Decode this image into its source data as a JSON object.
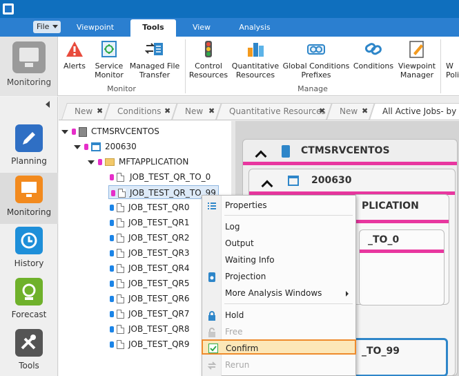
{
  "ribbon_tabs": [
    {
      "label": "Viewpoint"
    },
    {
      "label": "Tools",
      "active": true
    },
    {
      "label": "View"
    },
    {
      "label": "Analysis"
    }
  ],
  "file_button": {
    "label": "File"
  },
  "monitoring_panel": {
    "label": "Monitoring"
  },
  "ribbon": {
    "monitor_group": {
      "label": "Monitor",
      "buttons": [
        {
          "label": "Alerts",
          "icon": "alert-icon"
        },
        {
          "label": "Service Monitor",
          "line1": "Service",
          "line2": "Monitor",
          "icon": "service-monitor-icon"
        },
        {
          "label": "Managed File Transfer",
          "line1": "Managed File",
          "line2": "Transfer",
          "icon": "file-transfer-icon"
        }
      ]
    },
    "manage_group": {
      "label": "Manage",
      "buttons": [
        {
          "label": "Control Resources",
          "line1": "Control",
          "line2": "Resources",
          "icon": "traffic-light-icon"
        },
        {
          "label": "Quantitative Resources",
          "line1": "Quantitative",
          "line2": "Resources",
          "icon": "quantitative-icon"
        },
        {
          "label": "Global Conditions Prefixes",
          "line1": "Global Conditions",
          "line2": "Prefixes",
          "icon": "global-conditions-icon"
        },
        {
          "label": "Conditions",
          "icon": "conditions-icon"
        },
        {
          "label": "Viewpoint Manager",
          "line1": "Viewpoint",
          "line2": "Manager",
          "icon": "viewpoint-manager-icon"
        }
      ]
    },
    "cut_off": {
      "line1": "W",
      "line2": "Polic"
    }
  },
  "left_nav": [
    {
      "label": "Planning",
      "icon": "pencil-icon",
      "color": "#2f6fc4"
    },
    {
      "label": "Monitoring",
      "icon": "monitor-icon",
      "color": "#f28a1e",
      "active": true
    },
    {
      "label": "History",
      "icon": "history-icon",
      "color": "#1e8fd9"
    },
    {
      "label": "Forecast",
      "icon": "forecast-icon",
      "color": "#6fb12b"
    },
    {
      "label": "Tools",
      "icon": "tools-icon",
      "color": "#555555"
    }
  ],
  "doc_tabs": [
    {
      "label": "New"
    },
    {
      "label": "Conditions"
    },
    {
      "label": "New"
    },
    {
      "label": "Quantitative Resources"
    },
    {
      "label": "New"
    },
    {
      "label": "All Active Jobs- by OD"
    }
  ],
  "doc_tab_close": "✖",
  "tree": {
    "server": "CTMSRVCENTOS",
    "folder": "200630",
    "application": "MFTAPPLICATION",
    "jobs": [
      {
        "name": "JOB_TEST_QR_TO_0",
        "status": "pink",
        "locked": true
      },
      {
        "name": "JOB_TEST_QR_TO_99",
        "status": "pink",
        "selected": true
      },
      {
        "name": "JOB_TEST_QR0",
        "status": "blue"
      },
      {
        "name": "JOB_TEST_QR1",
        "status": "blue"
      },
      {
        "name": "JOB_TEST_QR2",
        "status": "blue"
      },
      {
        "name": "JOB_TEST_QR3",
        "status": "blue"
      },
      {
        "name": "JOB_TEST_QR4",
        "status": "blue"
      },
      {
        "name": "JOB_TEST_QR5",
        "status": "blue"
      },
      {
        "name": "JOB_TEST_QR6",
        "status": "blue"
      },
      {
        "name": "JOB_TEST_QR7",
        "status": "blue"
      },
      {
        "name": "JOB_TEST_QR8",
        "status": "blue"
      },
      {
        "name": "JOB_TEST_QR9",
        "status": "blue"
      }
    ]
  },
  "flow": {
    "server": "CTMSRVCENTOS",
    "folder": "200630",
    "application_partial": "PLICATION",
    "job1_partial": "_TO_0",
    "job2_partial": "_TO_99"
  },
  "context_menu": {
    "items": [
      {
        "label": "Properties",
        "icon": "properties-icon"
      },
      {
        "label": "Log"
      },
      {
        "label": "Output"
      },
      {
        "label": "Waiting Info"
      },
      {
        "label": "Projection",
        "icon": "projection-icon"
      },
      {
        "label": "More Analysis Windows",
        "submenu": true
      },
      {
        "label": "Hold",
        "icon": "lock-icon"
      },
      {
        "label": "Free",
        "icon": "unlock-icon",
        "disabled": true
      },
      {
        "label": "Confirm",
        "icon": "confirm-icon",
        "highlighted": true
      },
      {
        "label": "Rerun",
        "icon": "rerun-icon",
        "disabled": true
      }
    ]
  },
  "colors": {
    "title_bar": "#0f6fbe",
    "tab_bar": "#2b7fd0",
    "pink_status": "#e62ec9",
    "blue_status": "#1b84e7",
    "highlight_border": "#ee8a2c"
  }
}
